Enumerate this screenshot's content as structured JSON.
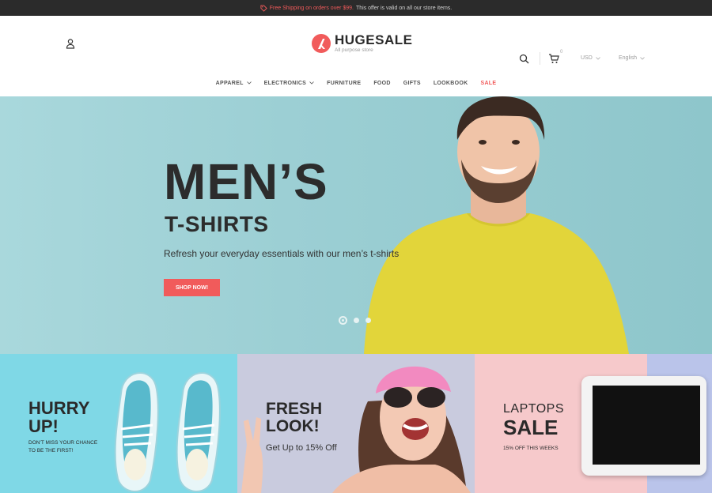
{
  "topbar": {
    "icon": "tag-icon",
    "promo": "Free Shipping on orders over $99.",
    "note": "This offer is valid on all our store items."
  },
  "header": {
    "logo_name": "HUGESALE",
    "logo_sub": "All purpose store",
    "cart_count": "0",
    "currency": "USD",
    "language": "English"
  },
  "nav": {
    "items": [
      "APPAREL",
      "ELECTRONICS",
      "FURNITURE",
      "FOOD",
      "GIFTS",
      "LOOKBOOK",
      "SALE"
    ]
  },
  "hero": {
    "title": "MEN’S",
    "subtitle": "T-SHIRTS",
    "description": "Refresh your everyday essentials with our men’s t-shirts",
    "button": "SHOP NOW!",
    "slides": 3,
    "active_slide": 1
  },
  "banners": {
    "hurry": {
      "title_line1": "HURRY",
      "title_line2": "UP!",
      "sub_line1": "DON’T MISS YOUR CHANCE",
      "sub_line2": "TO BE THE FIRST!"
    },
    "fresh": {
      "title_line1": "FRESH",
      "title_line2": "LOOK!",
      "sub": "Get Up to 15% Off"
    },
    "laptops": {
      "small": "LAPTOPS",
      "title": "SALE",
      "sub": "15% OFF THIS WEEKS"
    }
  },
  "colors": {
    "accent": "#f15b5b",
    "topbar_bg": "#2b2b2b",
    "hero_bg": "#9ccfd4",
    "banner_blue": "#7fd8e6",
    "banner_lavender": "#c9cbde",
    "banner_pink": "#f6c9cb"
  }
}
